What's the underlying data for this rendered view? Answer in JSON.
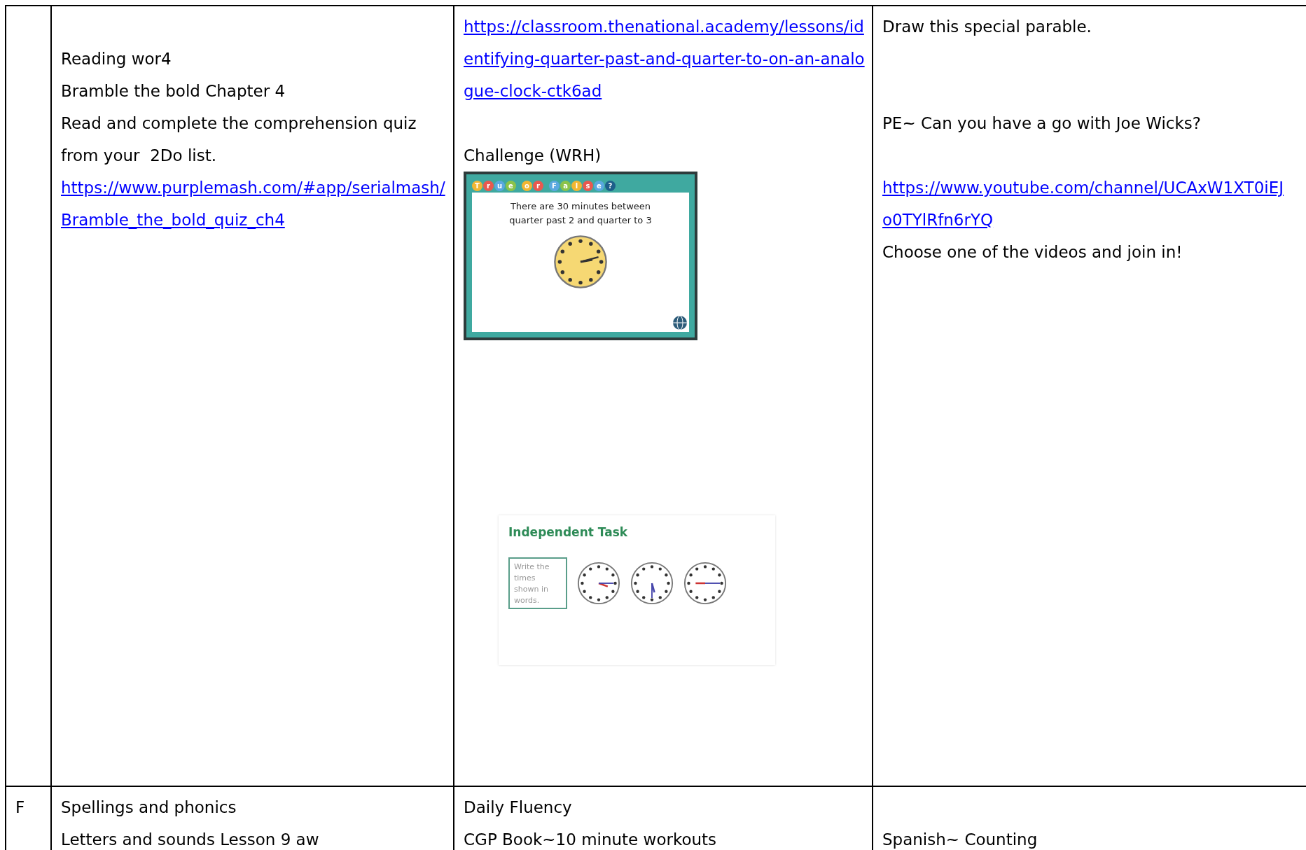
{
  "table": {
    "rows": [
      {
        "label": "",
        "cells": [
          [
            {
              "kind": "blank"
            },
            {
              "kind": "text",
              "text": "Reading wor4"
            },
            {
              "kind": "text",
              "text": "Bramble the bold Chapter 4"
            },
            {
              "kind": "text",
              "text": "Read and complete the comprehension quiz from your  2Do list."
            },
            {
              "kind": "link",
              "text": "https://www.purplemash.com/#app/serialmash/Bramble_the_bold_quiz_ch4"
            }
          ],
          [
            {
              "kind": "link",
              "text": "https://classroom.thenational.academy/lessons/identifying-quarter-past-and-quarter-to-on-an-analogue-clock-ctk6ad"
            },
            {
              "kind": "blank"
            },
            {
              "kind": "text",
              "text": "Challenge (WRH)"
            },
            {
              "kind": "quiz_slide",
              "letters": [
                "T",
                "r",
                "u",
                "e",
                "o",
                "r",
                "F",
                "a",
                "l",
                "s",
                "e",
                "?"
              ],
              "question": "There are 30 minutes between quarter past 2 and quarter to 3"
            },
            {
              "kind": "task_slide",
              "title": "Independent Task",
              "bullet": "Write the times shown in words."
            }
          ],
          [
            {
              "kind": "text",
              "text": "Draw this special parable."
            },
            {
              "kind": "blank"
            },
            {
              "kind": "blank"
            },
            {
              "kind": "text",
              "text": "PE~ Can you have a go with Joe Wicks?"
            },
            {
              "kind": "blank"
            },
            {
              "kind": "link",
              "text": "https://www.youtube.com/channel/UCAxW1XT0iEJo0TYlRfn6rYQ"
            },
            {
              "kind": "text",
              "text": "Choose one of the videos and join in!"
            }
          ]
        ]
      },
      {
        "label": "F",
        "cells": [
          [
            {
              "kind": "text",
              "text": "Spellings and phonics"
            },
            {
              "kind": "text",
              "text": "Letters and sounds Lesson 9 aw"
            }
          ],
          [
            {
              "kind": "text",
              "text": "Daily Fluency"
            },
            {
              "kind": "text",
              "text": "CGP Book~10 minute workouts"
            }
          ],
          [
            {
              "kind": "blank"
            },
            {
              "kind": "text",
              "text": "Spanish~ Counting"
            }
          ]
        ]
      }
    ]
  }
}
